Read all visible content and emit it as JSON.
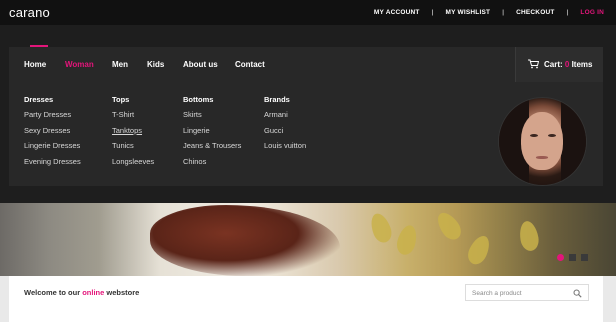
{
  "brand": {
    "logo": "carano"
  },
  "top_links": [
    {
      "label": "MY ACCOUNT"
    },
    {
      "label": "MY WISHLIST"
    },
    {
      "label": "CHECKOUT"
    },
    {
      "label": "LOG IN"
    }
  ],
  "nav": {
    "items": [
      {
        "label": "Home"
      },
      {
        "label": "Woman"
      },
      {
        "label": "Men"
      },
      {
        "label": "Kids"
      },
      {
        "label": "About us"
      },
      {
        "label": "Contact"
      }
    ],
    "active": "Woman",
    "cart": {
      "label": "Cart: ",
      "count": "0",
      "suffix": " Items",
      "icon": "cart-icon"
    }
  },
  "mega_menu": {
    "columns": [
      {
        "heading": "Dresses",
        "items": [
          "Party Dresses",
          "Sexy Dresses",
          "Lingerie Dresses",
          "Evening Dresses"
        ]
      },
      {
        "heading": "Tops",
        "items": [
          "T-Shirt",
          "Tanktops",
          "Tunics",
          "Longsleeves"
        ]
      },
      {
        "heading": "Bottoms",
        "items": [
          "Skirts",
          "Lingerie",
          "Jeans & Trousers",
          "Chinos"
        ]
      },
      {
        "heading": "Brands",
        "items": [
          "Armani",
          "Gucci",
          "Louis vuitton"
        ]
      }
    ],
    "underlined_item": "Tanktops"
  },
  "hero": {
    "slide_count": 3,
    "active_slide": 1
  },
  "footer": {
    "welcome_prefix": "Welcome to our ",
    "welcome_highlight": "online",
    "welcome_suffix": " webstore",
    "search_placeholder": "Search a product",
    "search_icon": "search-icon"
  },
  "colors": {
    "accent": "#e3157a",
    "topbar": "#111111",
    "menu_bg": "#282828"
  }
}
